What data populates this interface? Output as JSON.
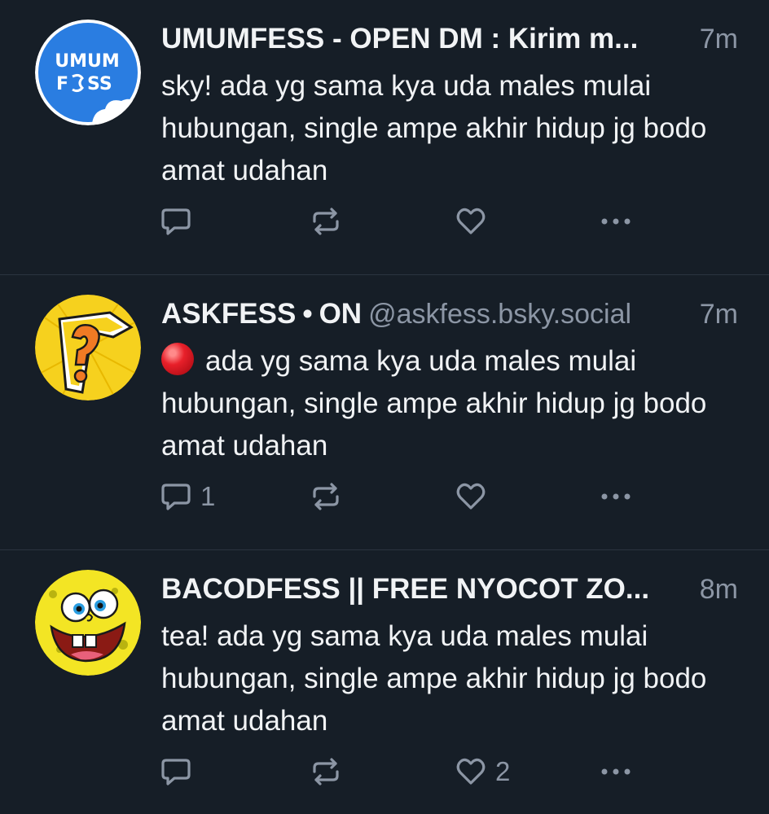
{
  "posts": [
    {
      "display_name": "UMUMFESS - OPEN DM : Kirim m...",
      "separator": "",
      "handle": "",
      "time": "7m",
      "avatar_text_top": "UMUM",
      "avatar_text_bottom_left": "F",
      "avatar_text_bottom_right": "SS",
      "text": "sky! ada yg sama kya uda males mulai hubungan, single ampe akhir hidup jg bodo amat udahan",
      "reply_count": "",
      "like_count": ""
    },
    {
      "display_name": "ASKFESS",
      "separator": "•",
      "status": "ON",
      "handle": "@askfess.bsky.social",
      "time": "7m",
      "text": "ada yg sama kya uda males mulai hubungan, single ampe akhir hidup jg bodo amat udahan",
      "reply_count": "1",
      "like_count": ""
    },
    {
      "display_name": "BACODFESS || FREE NYOCOT ZO...",
      "separator": "",
      "handle": "",
      "time": "8m",
      "text": "tea! ada yg sama kya uda males mulai hubungan, single ampe akhir hidup jg bodo amat udahan",
      "reply_count": "",
      "like_count": "2"
    }
  ],
  "icons": {
    "reply": "speech-bubble-icon",
    "repost": "repost-arrows-icon",
    "like": "heart-icon",
    "more": "ellipsis-icon",
    "red_ball": "red-circle-emoji"
  },
  "colors": {
    "background": "#161e27",
    "text": "#f1f3f5",
    "muted": "#8c96a5",
    "divider": "#2b3440"
  }
}
